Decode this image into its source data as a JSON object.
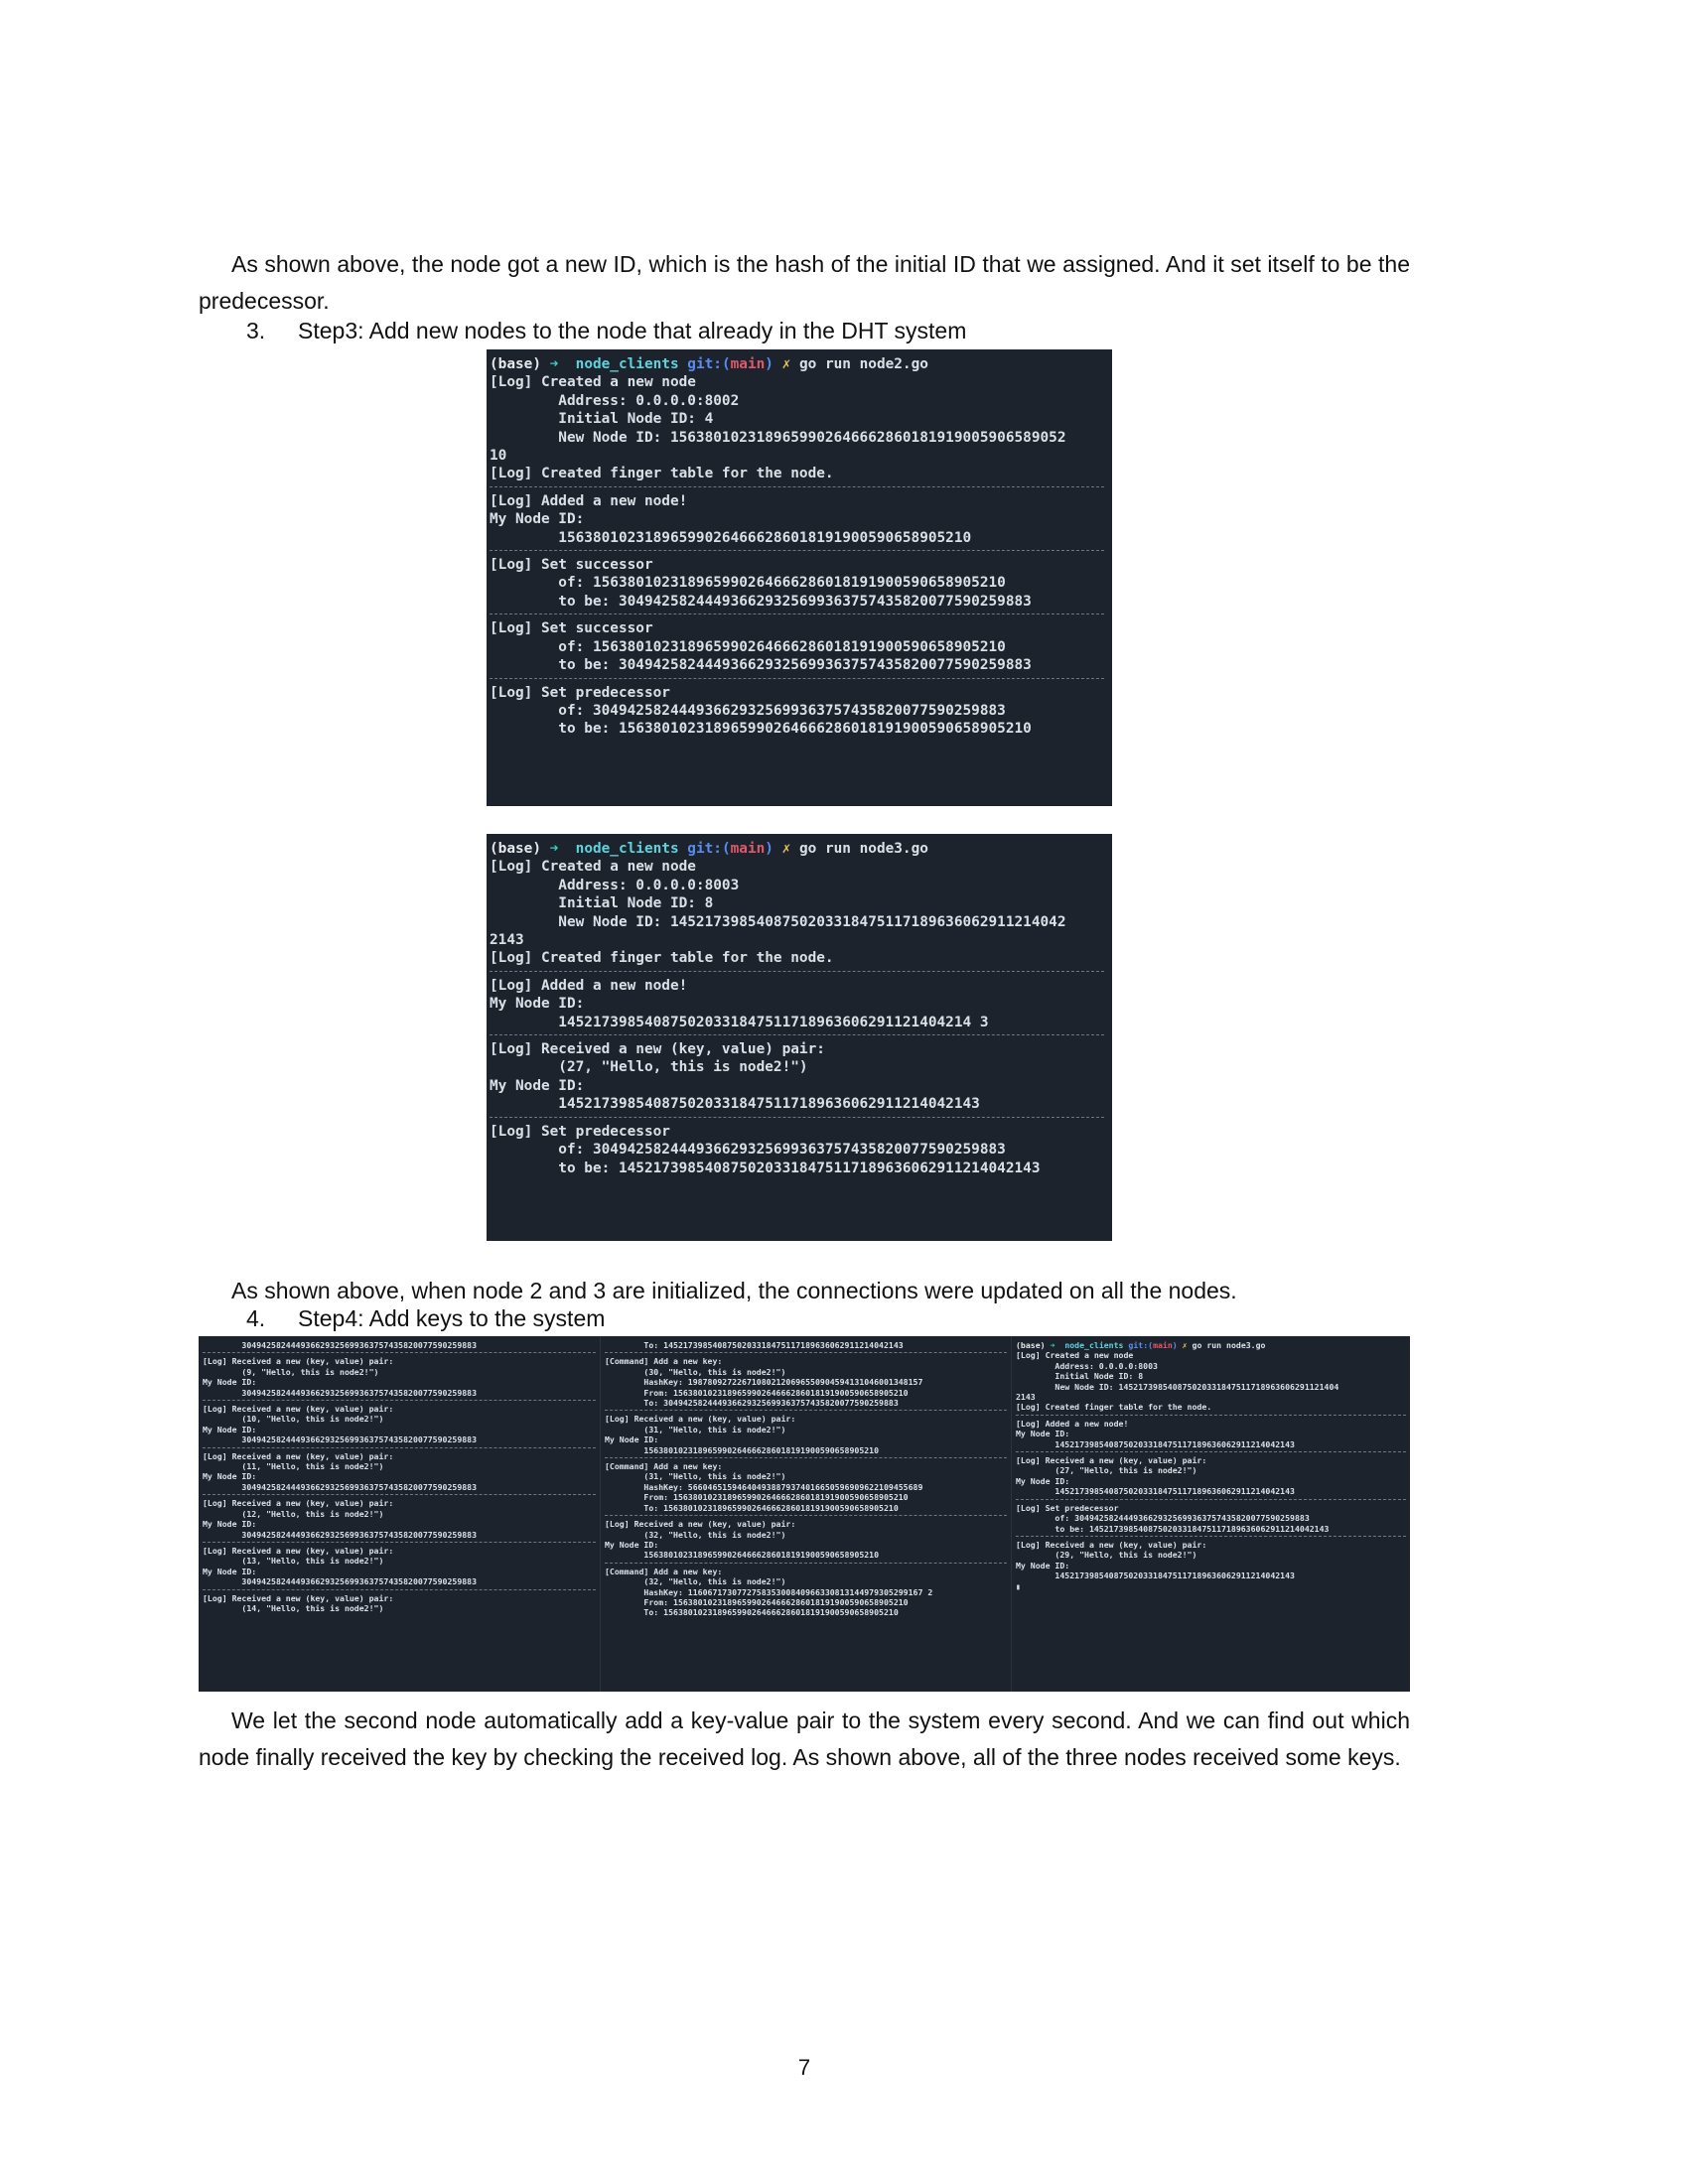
{
  "paragraphs": {
    "p1": "As shown above, the node got a new ID, which is the hash of the initial ID that we assigned. And it set itself to be the predecessor.",
    "p2": "As shown above, when node 2 and 3 are initialized, the connections were updated on all the nodes.",
    "p3": "We let the second node automatically add a key-value pair to the system every second. And we can find out which node finally received the key by checking the received log. As shown above, all of the three nodes received some keys."
  },
  "steps": {
    "step3": {
      "number": "3.",
      "text": "Step3: Add new nodes to the node that already in the DHT system"
    },
    "step4": {
      "number": "4.",
      "text": "Step4: Add keys to the system"
    }
  },
  "prompt": {
    "base": "(base)",
    "arrow": "➜",
    "dir": "node_clients",
    "git": "git:(",
    "branch": "main",
    "git_close": ")",
    "x": "✗"
  },
  "terminal1": {
    "command": "go run node2.go",
    "lines": [
      "[Log] Created a new node",
      "        Address: 0.0.0.0:8002",
      "        Initial Node ID: 4",
      "        New Node ID: 1563801023189659902646662860181919005906589052",
      "10",
      "[Log] Created finger table for the node.",
      "---",
      "[Log] Added a new node!",
      "My Node ID:",
      "        156380102318965990264666286018191900590658905210",
      "---",
      "[Log] Set successor",
      "        of: 156380102318965990264666286018191900590658905210",
      "        to be: 304942582444936629325699363757435820077590259883",
      "---",
      "[Log] Set successor",
      "        of: 156380102318965990264666286018191900590658905210",
      "        to be: 304942582444936629325699363757435820077590259883",
      "---",
      "[Log] Set predecessor",
      "        of: 304942582444936629325699363757435820077590259883",
      "        to be: 156380102318965990264666286018191900590658905210"
    ]
  },
  "terminal2": {
    "command": "go run node3.go",
    "lines": [
      "[Log] Created a new node",
      "        Address: 0.0.0.0:8003",
      "        Initial Node ID: 8",
      "        New Node ID: 1452173985408750203318475117189636062911214042",
      "2143",
      "[Log] Created finger table for the node.",
      "---",
      "[Log] Added a new node!",
      "My Node ID:",
      "        145217398540875020331847511718963606291121404214 3",
      "---",
      "[Log] Received a new (key, value) pair:",
      "        (27, \"Hello, this is node2!\")",
      "My Node ID:",
      "        1452173985408750203318475117189636062911214042143",
      "---",
      "[Log] Set predecessor",
      "        of: 304942582444936629325699363757435820077590259883",
      "        to be: 1452173985408750203318475117189636062911214042143"
    ]
  },
  "terminal3": {
    "lines": [
      "        304942582444936629325699363757435820077590259883",
      "---",
      "[Log] Received a new (key, value) pair:",
      "        (9, \"Hello, this is node2!\")",
      "My Node ID:",
      "        304942582444936629325699363757435820077590259883",
      "---",
      "[Log] Received a new (key, value) pair:",
      "        (10, \"Hello, this is node2!\")",
      "My Node ID:",
      "        304942582444936629325699363757435820077590259883",
      "---",
      "[Log] Received a new (key, value) pair:",
      "        (11, \"Hello, this is node2!\")",
      "My Node ID:",
      "        304942582444936629325699363757435820077590259883",
      "---",
      "[Log] Received a new (key, value) pair:",
      "        (12, \"Hello, this is node2!\")",
      "My Node ID:",
      "        304942582444936629325699363757435820077590259883",
      "---",
      "[Log] Received a new (key, value) pair:",
      "        (13, \"Hello, this is node2!\")",
      "My Node ID:",
      "        304942582444936629325699363757435820077590259883",
      "---",
      "[Log] Received a new (key, value) pair:",
      "        (14, \"Hello, this is node2!\")"
    ]
  },
  "terminal4": {
    "lines": [
      "        To: 1452173985408750203318475117189636062911214042143",
      "---",
      "[Command] Add a new key:",
      "        (30, \"Hello, this is node2!\")",
      "        HashKey: 198780927226710802120696550904594131046001348157",
      "        From: 156380102318965990264666286018191900590658905210",
      "        To: 304942582444936629325699363757435820077590259883",
      "---",
      "[Log] Received a new (key, value) pair:",
      "        (31, \"Hello, this is node2!\")",
      "My Node ID:",
      "        156380102318965990264666286018191900590658905210",
      "---",
      "[Command] Add a new key:",
      "        (31, \"Hello, this is node2!\")",
      "        HashKey: 566046515946404938879374016650596909622109455689",
      "        From: 156380102318965990264666286018191900590658905210",
      "        To: 156380102318965990264666286018191900590658905210",
      "---",
      "[Log] Received a new (key, value) pair:",
      "        (32, \"Hello, this is node2!\")",
      "My Node ID:",
      "        156380102318965990264666286018191900590658905210",
      "---",
      "[Command] Add a new key:",
      "        (32, \"Hello, this is node2!\")",
      "        HashKey: 116067173077275835300840966330813144979305299167 2",
      "        From: 156380102318965990264666286018191900590658905210",
      "        To: 156380102318965990264666286018191900590658905210"
    ]
  },
  "terminal5": {
    "command": "go run node3.go",
    "lines": [
      "[Log] Created a new node",
      "        Address: 0.0.0.0:8003",
      "        Initial Node ID: 8",
      "        New Node ID: 145217398540875020331847511718963606291121404",
      "2143",
      "[Log] Created finger table for the node.",
      "---",
      "[Log] Added a new node!",
      "My Node ID:",
      "        1452173985408750203318475117189636062911214042143",
      "---",
      "[Log] Received a new (key, value) pair:",
      "        (27, \"Hello, this is node2!\")",
      "My Node ID:",
      "        1452173985408750203318475117189636062911214042143",
      "---",
      "[Log] Set predecessor",
      "        of: 304942582444936629325699363757435820077590259883",
      "        to be: 1452173985408750203318475117189636062911214042143",
      "---",
      "[Log] Received a new (key, value) pair:",
      "        (29, \"Hello, this is node2!\")",
      "My Node ID:",
      "        1452173985408750203318475117189636062911214042143",
      "▮"
    ]
  },
  "page_number": "7"
}
